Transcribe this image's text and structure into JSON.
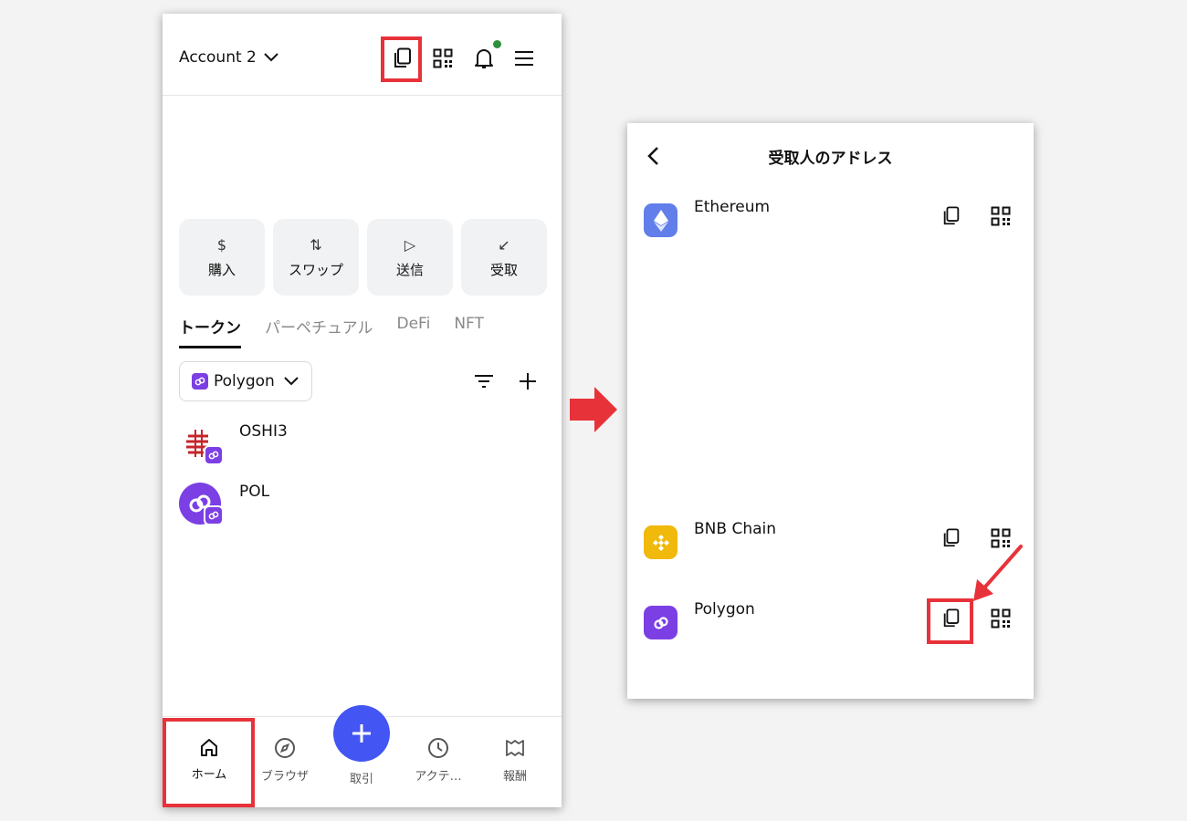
{
  "left_screen": {
    "header": {
      "account_label": "Account 2",
      "icons": [
        "copy-icon",
        "qr-code-icon",
        "bell-icon",
        "menu-icon"
      ],
      "notification_dot_color": "#2f8f3a"
    },
    "actions": [
      {
        "glyph": "$",
        "label": "購入"
      },
      {
        "glyph": "⇅",
        "label": "スワップ"
      },
      {
        "glyph": "▷",
        "label": "送信"
      },
      {
        "glyph": "↙",
        "label": "受取"
      }
    ],
    "tabs": [
      {
        "label": "トークン",
        "active": true
      },
      {
        "label": "パーペチュアル",
        "active": false
      },
      {
        "label": "DeFi",
        "active": false
      },
      {
        "label": "NFT",
        "active": false
      }
    ],
    "network_selector": {
      "label": "Polygon"
    },
    "tokens": [
      {
        "name": "OSHI3"
      },
      {
        "name": "POL"
      }
    ],
    "bottom_nav": {
      "home": "ホーム",
      "browser": "ブラウザ",
      "trade": "取引",
      "activity": "アクテ…",
      "rewards": "報酬"
    }
  },
  "right_screen": {
    "title": "受取人のアドレス",
    "chains": [
      {
        "name": "Ethereum",
        "color": "#627eea"
      },
      {
        "name": "BNB Chain",
        "color": "#f0b90b"
      },
      {
        "name": "Polygon",
        "color": "#7b3fe4"
      }
    ]
  },
  "colors": {
    "highlight": "#e8323a",
    "accent": "#4355f2",
    "polygon": "#7b3fe4"
  }
}
